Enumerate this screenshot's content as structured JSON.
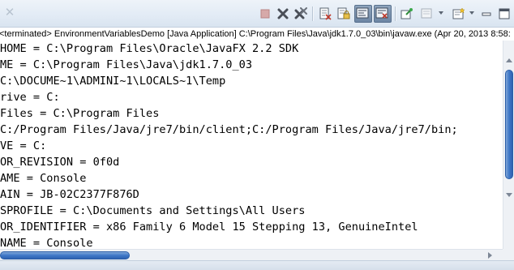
{
  "toolbar": {
    "close_glyph": "✕",
    "buttons": [
      {
        "icon": "terminate-icon"
      },
      {
        "icon": "remove-launch-icon"
      },
      {
        "icon": "remove-all-terminated-icon"
      },
      {
        "icon": "clear-console-icon"
      },
      {
        "icon": "scroll-lock-icon"
      },
      {
        "icon": "word-wrap-icon"
      },
      {
        "icon": "show-console-on-output-icon"
      },
      {
        "icon": "pin-console-icon"
      },
      {
        "icon": "display-selected-console-icon"
      },
      {
        "icon": "open-console-icon"
      }
    ]
  },
  "process_label": "<terminated> EnvironmentVariablesDemo [Java Application] C:\\Program Files\\Java\\jdk1.7.0_03\\bin\\javaw.exe (Apr 20, 2013 8:58:",
  "console": {
    "lines": [
      "HOME = C:\\Program Files\\Oracle\\JavaFX 2.2 SDK",
      "ME = C:\\Program Files\\Java\\jdk1.7.0_03",
      "C:\\DOCUME~1\\ADMINI~1\\LOCALS~1\\Temp",
      "rive = C:",
      "Files = C:\\Program Files",
      "C:/Program Files/Java/jre7/bin/client;C:/Program Files/Java/jre7/bin;",
      "VE = C:",
      "OR_REVISION = 0f0d",
      "AME = Console",
      "AIN = JB-02C2377F876D",
      "SPROFILE = C:\\Documents and Settings\\All Users",
      "OR_IDENTIFIER = x86 Family 6 Model 15 Stepping 13, GenuineIntel",
      "NAME = Console"
    ]
  },
  "colors": {
    "scroll_thumb": "#3f78c8",
    "toolbar_bg": "#e2ebf5",
    "terminate_disabled": "#c99a9a"
  }
}
